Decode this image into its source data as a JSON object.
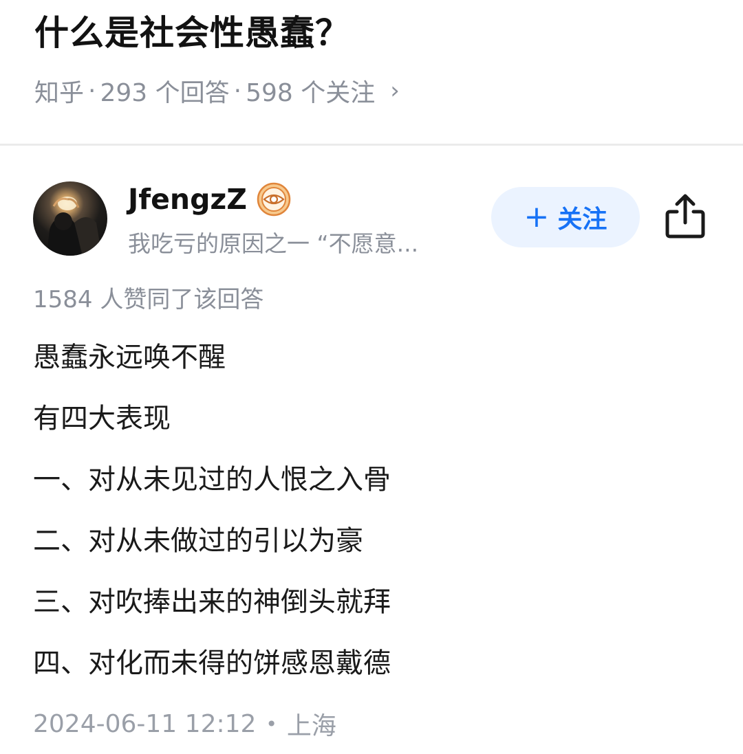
{
  "question": {
    "title": "什么是社会性愚蠢？",
    "source": "知乎",
    "answers": "293 个回答",
    "followers": "598 个关注",
    "separator": "·",
    "chevron": "›"
  },
  "author": {
    "name": "JfengzZ",
    "badge_icon": "eye-badge-icon",
    "bio": "我吃亏的原因之一 “不愿意...",
    "follow_plus": "+",
    "follow_label": "关注",
    "share_icon": "share-icon"
  },
  "answer": {
    "vote_text": "1584 人赞同了该回答",
    "lines": [
      "愚蠢永远唤不醒",
      "有四大表现",
      "一、对从未见过的人恨之入骨",
      "二、对从未做过的引以为豪",
      "三、对吹捧出来的神倒头就拜",
      "四、对化而未得的饼感恩戴德"
    ],
    "datetime": "2024-06-11 12:12",
    "dot": "•",
    "location": "上海"
  },
  "colors": {
    "accent": "#1772f6",
    "follow_bg": "#ebf3ff",
    "meta_gray": "#8a8f99",
    "badge_orange": "#e8954a"
  }
}
